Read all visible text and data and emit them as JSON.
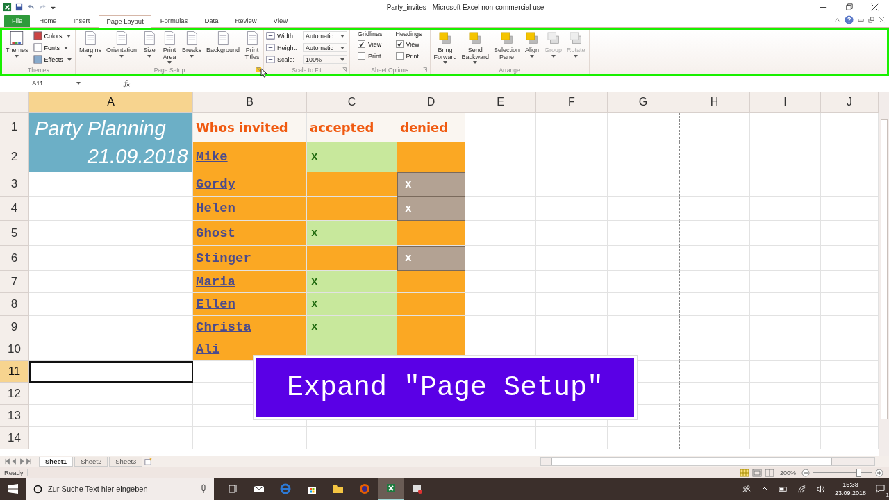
{
  "title_bar": {
    "title": "Party_invites  -  Microsoft Excel non-commercial use"
  },
  "ribbon_tabs": [
    {
      "label": "File",
      "kind": "file",
      "selected": false
    },
    {
      "label": "Home",
      "kind": "tab",
      "selected": false
    },
    {
      "label": "Insert",
      "kind": "tab",
      "selected": false
    },
    {
      "label": "Page Layout",
      "kind": "tab",
      "selected": true
    },
    {
      "label": "Formulas",
      "kind": "tab",
      "selected": false
    },
    {
      "label": "Data",
      "kind": "tab",
      "selected": false
    },
    {
      "label": "Review",
      "kind": "tab",
      "selected": false
    },
    {
      "label": "View",
      "kind": "tab",
      "selected": false
    }
  ],
  "ribbon_groups": [
    {
      "name": "Themes",
      "controls": [
        {
          "kind": "large",
          "lines": [
            "Themes"
          ],
          "dropdown": true
        },
        {
          "kind": "stack",
          "items": [
            {
              "label": "Colors"
            },
            {
              "label": "Fonts"
            },
            {
              "label": "Effects"
            }
          ]
        }
      ]
    },
    {
      "name": "Page Setup",
      "launcher": {
        "hovered": true
      },
      "controls": [
        {
          "kind": "large",
          "lines": [
            "Margins"
          ],
          "dropdown": true
        },
        {
          "kind": "large",
          "lines": [
            "Orientation"
          ],
          "dropdown": true
        },
        {
          "kind": "large",
          "lines": [
            "Size"
          ],
          "dropdown": true
        },
        {
          "kind": "large",
          "lines": [
            "Print",
            "Area"
          ],
          "dropdown": true
        },
        {
          "kind": "large",
          "lines": [
            "Breaks"
          ],
          "dropdown": true
        },
        {
          "kind": "large",
          "lines": [
            "Background"
          ],
          "dropdown": false
        },
        {
          "kind": "large",
          "lines": [
            "Print",
            "Titles"
          ],
          "dropdown": false
        }
      ]
    },
    {
      "name": "Scale to Fit",
      "launcher": {
        "hovered": false
      },
      "controls": [
        {
          "kind": "fields",
          "items": [
            {
              "label": "Width:",
              "value": "Automatic"
            },
            {
              "label": "Height:",
              "value": "Automatic"
            },
            {
              "label": "Scale:",
              "value": "100%"
            }
          ]
        }
      ]
    },
    {
      "name": "Sheet Options",
      "launcher": {
        "hovered": false
      },
      "controls": [
        {
          "kind": "checks",
          "heading": "Gridlines",
          "items": [
            {
              "label": "View",
              "checked": true
            },
            {
              "label": "Print",
              "checked": false
            }
          ]
        },
        {
          "kind": "checks",
          "heading": "Headings",
          "items": [
            {
              "label": "View",
              "checked": true
            },
            {
              "label": "Print",
              "checked": false
            }
          ]
        }
      ]
    },
    {
      "name": "Arrange",
      "controls": [
        {
          "kind": "large",
          "lines": [
            "Bring",
            "Forward"
          ],
          "dropdown": true,
          "disabled": false
        },
        {
          "kind": "large",
          "lines": [
            "Send",
            "Backward"
          ],
          "dropdown": true,
          "disabled": false
        },
        {
          "kind": "large",
          "lines": [
            "Selection",
            "Pane"
          ],
          "dropdown": false,
          "disabled": false
        },
        {
          "kind": "large",
          "lines": [
            "Align"
          ],
          "dropdown": true,
          "disabled": false
        },
        {
          "kind": "large",
          "lines": [
            "Group"
          ],
          "dropdown": true,
          "disabled": true
        },
        {
          "kind": "large",
          "lines": [
            "Rotate"
          ],
          "dropdown": true,
          "disabled": true
        }
      ]
    }
  ],
  "formula_bar": {
    "name_box": "A11"
  },
  "columns": [
    {
      "label": "A",
      "selected": true
    },
    {
      "label": "B",
      "selected": false
    },
    {
      "label": "C",
      "selected": false
    },
    {
      "label": "D",
      "selected": false
    },
    {
      "label": "E",
      "selected": false
    },
    {
      "label": "F",
      "selected": false
    },
    {
      "label": "G",
      "selected": false
    },
    {
      "label": "H",
      "selected": false
    },
    {
      "label": "I",
      "selected": false
    },
    {
      "label": "J",
      "selected": false
    }
  ],
  "rows": [
    {
      "label": "1",
      "selected": false
    },
    {
      "label": "2",
      "selected": false
    },
    {
      "label": "3",
      "selected": false
    },
    {
      "label": "4",
      "selected": false
    },
    {
      "label": "5",
      "selected": false
    },
    {
      "label": "6",
      "selected": false
    },
    {
      "label": "7",
      "selected": false
    },
    {
      "label": "8",
      "selected": false
    },
    {
      "label": "9",
      "selected": false
    },
    {
      "label": "10",
      "selected": false
    },
    {
      "label": "11",
      "selected": true
    },
    {
      "label": "12",
      "selected": false
    },
    {
      "label": "13",
      "selected": false
    },
    {
      "label": "14",
      "selected": false
    }
  ],
  "sheet": {
    "title": "Party Planning",
    "date": "21.09.2018",
    "headers": [
      "Whos invited",
      "accepted",
      "denied"
    ],
    "guests": [
      {
        "name": "Mike",
        "accepted": true,
        "denied": false,
        "mark": "x"
      },
      {
        "name": "Gordy",
        "accepted": false,
        "denied": true,
        "mark": "x"
      },
      {
        "name": "Helen",
        "accepted": false,
        "denied": true,
        "mark": "x"
      },
      {
        "name": "Ghost",
        "accepted": true,
        "denied": false,
        "mark": "x"
      },
      {
        "name": "Stinger",
        "accepted": false,
        "denied": true,
        "mark": "x"
      },
      {
        "name": "Maria",
        "accepted": true,
        "denied": false,
        "mark": "x"
      },
      {
        "name": "Ellen",
        "accepted": true,
        "denied": false,
        "mark": "x"
      },
      {
        "name": "Christa",
        "accepted": true,
        "denied": false,
        "mark": "x"
      },
      {
        "name": "Ali",
        "accepted": true,
        "denied": false
      }
    ]
  },
  "caption": "Expand \"Page Setup\"",
  "sheet_tabs": [
    {
      "label": "Sheet1",
      "selected": true
    },
    {
      "label": "Sheet2",
      "selected": false
    },
    {
      "label": "Sheet3",
      "selected": false
    }
  ],
  "status_bar": {
    "status": "Ready",
    "zoom": "200%",
    "level": 0.77
  },
  "taskbar": {
    "search_placeholder": "Zur Suche Text hier eingeben",
    "time": "15:38",
    "date": "23.09.2018",
    "notifications": "1"
  }
}
